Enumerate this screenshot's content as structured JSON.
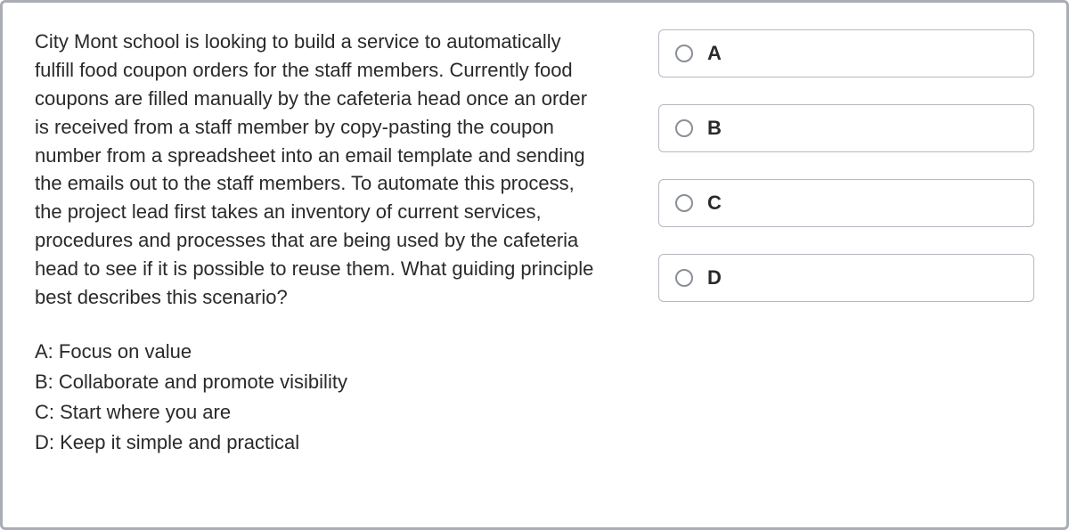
{
  "question": "City Mont school is looking to build a service to automatically fulfill food coupon orders for the staff members. Currently food coupons are filled manually by the cafeteria head once an order is received from a staff member by copy-pasting the coupon number from a spreadsheet into an email template and sending the emails out to the staff members. To automate this process, the project lead first takes an inventory of current services, procedures and processes that are being used by the cafeteria head to see if it is possible to reuse them. What guiding principle best describes this scenario?",
  "answers": {
    "a": "A: Focus on value",
    "b": "B: Collaborate and promote visibility",
    "c": "C: Start where you are",
    "d": "D: Keep it simple and practical"
  },
  "options": {
    "a": "A",
    "b": "B",
    "c": "C",
    "d": "D"
  }
}
